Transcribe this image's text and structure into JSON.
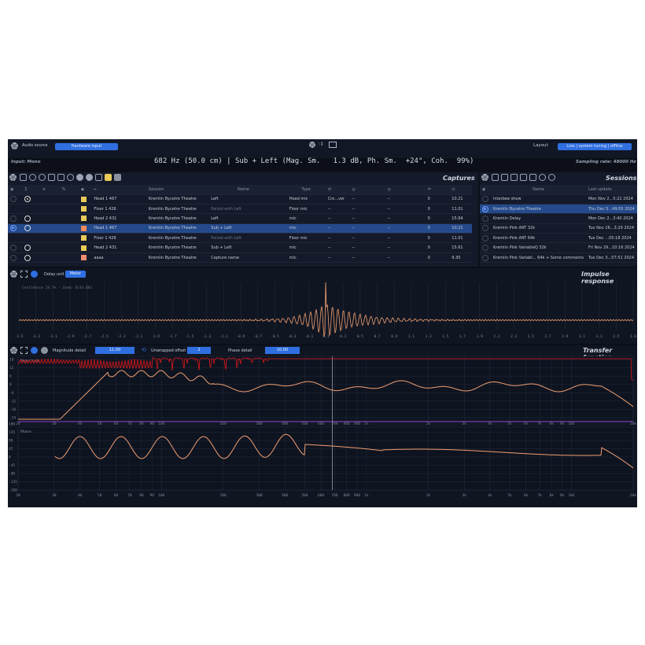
{
  "top": {
    "audio_source_label": "Audio source",
    "hardware_input": "Hardware input",
    "input_label": "Input: Mono",
    "readout": "682 Hz (50.0 cm) | Sub + Left (Mag. Sm.   1.3 dB, Ph. Sm.  +24°, Coh.  99%)",
    "layout_label": "Layout",
    "layout_value": "Live | system tuning | offline",
    "sampling": "Sampling rate: 48000 Hz"
  },
  "captures": {
    "title": "Captures",
    "columns": [
      "",
      "",
      "",
      "",
      "",
      "",
      "Session",
      "Name",
      "Type",
      "",
      "",
      "",
      "",
      "",
      ""
    ],
    "rows": [
      {
        "name": "Head 1 467",
        "color": "#e8c95a",
        "session": "Kremlin Bycetre Theatre",
        "cname": "Left",
        "type": "Head mic",
        "a": "Cro...ver",
        "b": "--",
        "c": "--",
        "d": "0",
        "e": "10.21",
        "dim": false,
        "sel": false,
        "v": "dim",
        "s": "on"
      },
      {
        "name": "Floor 1 426",
        "color": "#e8c95a",
        "session": "Kremlin Bycetre Theatre",
        "cname": "Paired with Left",
        "type": "Floor mic",
        "a": "--",
        "b": "--",
        "c": "--",
        "d": "0",
        "e": "11.01",
        "dim": true,
        "sel": false,
        "v": "none",
        "s": "none"
      },
      {
        "name": "Head 2 431",
        "color": "#e8c95a",
        "session": "Kremlin Bycetre Theatre",
        "cname": "Left",
        "type": "mic",
        "a": "--",
        "b": "--",
        "c": "--",
        "d": "0",
        "e": "15.64",
        "dim": false,
        "sel": false,
        "v": "dim",
        "s": "open"
      },
      {
        "name": "Head 1 467",
        "color": "#f08a5a",
        "session": "Kremlin Bycetre Theatre",
        "cname": "Sub + Left",
        "type": "mic",
        "a": "--",
        "b": "--",
        "c": "--",
        "d": "0",
        "e": "10.21",
        "dim": false,
        "sel": true,
        "v": "play",
        "s": "open"
      },
      {
        "name": "Floor 1 426",
        "color": "#e8c95a",
        "session": "Kremlin Bycetre Theatre",
        "cname": "Paired with Left",
        "type": "Floor mic",
        "a": "--",
        "b": "--",
        "c": "--",
        "d": "0",
        "e": "11.01",
        "dim": true,
        "sel": false,
        "v": "none",
        "s": "none"
      },
      {
        "name": "Head 2 431",
        "color": "#e8c95a",
        "session": "Kremlin Bycetre Theatre",
        "cname": "Sub + Left",
        "type": "mic",
        "a": "--",
        "b": "--",
        "c": "--",
        "d": "0",
        "e": "15.61",
        "dim": false,
        "sel": false,
        "v": "dim",
        "s": "open"
      },
      {
        "name": "aaaa",
        "color": "#f08a70",
        "session": "Kremlin Bycetre Theatre",
        "cname": "Capture name",
        "type": "mic",
        "a": "--",
        "b": "--",
        "c": "--",
        "d": "0",
        "e": "9.30",
        "dim": false,
        "sel": false,
        "v": "dim",
        "s": "open"
      }
    ]
  },
  "sessions": {
    "title": "Sessions",
    "col_name": "Name",
    "col_update": "Last update",
    "rows": [
      {
        "name": "Interbee show",
        "date": "Mon Nov 2...5:22 2024",
        "sel": false
      },
      {
        "name": "Kremlin Bycetre Theatre",
        "date": "Thu Dec 5...49:55 2024",
        "sel": true
      },
      {
        "name": "Kremlin Delay",
        "date": "Mon Dec 2...3:40 2024",
        "sel": false
      },
      {
        "name": "Kremlin Pink ART 32k",
        "date": "Tue Nov 26...3:29 2024",
        "sel": false
      },
      {
        "name": "Kremlin Pink ART 64k",
        "date": "Tue Dec ...05:18 2024",
        "sel": false
      },
      {
        "name": "Kremlin Pink VariableQ 32k",
        "date": "Fri Nov 29...10:16 2024",
        "sel": false
      },
      {
        "name": "Kremlin Pink Variabl... 64k + Some comments",
        "date": "Tue Dec 3...07:51 2024",
        "sel": false
      }
    ]
  },
  "impulse": {
    "title": "Impulse response",
    "delay_unit": "Delay unit",
    "meter": "Meter",
    "overlay": "Confidence 24.7% - Zoom: 0[43.00]",
    "ticks": [
      "-3.5",
      "-3.3",
      "-3.1",
      "-2.9",
      "-2.7",
      "-2.5",
      "-2.3",
      "-2.1",
      "-1.9",
      "-1.7",
      "-1.5",
      "-1.3",
      "-1.1",
      "-0.9",
      "-0.7",
      "-0.5",
      "-0.3",
      "-0.1",
      "0.1",
      "0.3",
      "0.5",
      "0.7",
      "0.9",
      "1.1",
      "1.3",
      "1.5",
      "1.7",
      "1.9",
      "2.1",
      "2.3",
      "2.5",
      "2.7",
      "2.9",
      "3.1",
      "3.3",
      "3.5",
      "3.6"
    ]
  },
  "transfer": {
    "title": "Transfer function",
    "mag_detail": "Magnitude detail",
    "mag_val": "11.00",
    "unwrapped": "Unwrapped offset",
    "unwrapped_val": "2",
    "phase_detail": "Phase detail",
    "phase_val": "10.00",
    "magnitude_label": "Magnitude",
    "phase_label": "Phase",
    "mag_ticks": [
      "18",
      "12",
      "6",
      "0",
      "-6",
      "-12",
      "-18",
      "-24"
    ],
    "phase_ticks": [
      "180",
      "135",
      "90",
      "45",
      "0",
      "-45",
      "-90",
      "-135",
      "-180"
    ],
    "freq_ticks": [
      "20",
      "30",
      "40",
      "50",
      "60",
      "70",
      "80",
      "90",
      "100",
      "200",
      "300",
      "400",
      "500",
      "600",
      "700",
      "800",
      "900",
      "1k",
      "2k",
      "3k",
      "4k",
      "5k",
      "6k",
      "7k",
      "8k",
      "9k",
      "10k",
      "20k"
    ]
  },
  "colors": {
    "accent": "#2f6fe0",
    "trace": "#f0a070",
    "coherence": "#e01818",
    "background": "#0c0f18"
  }
}
